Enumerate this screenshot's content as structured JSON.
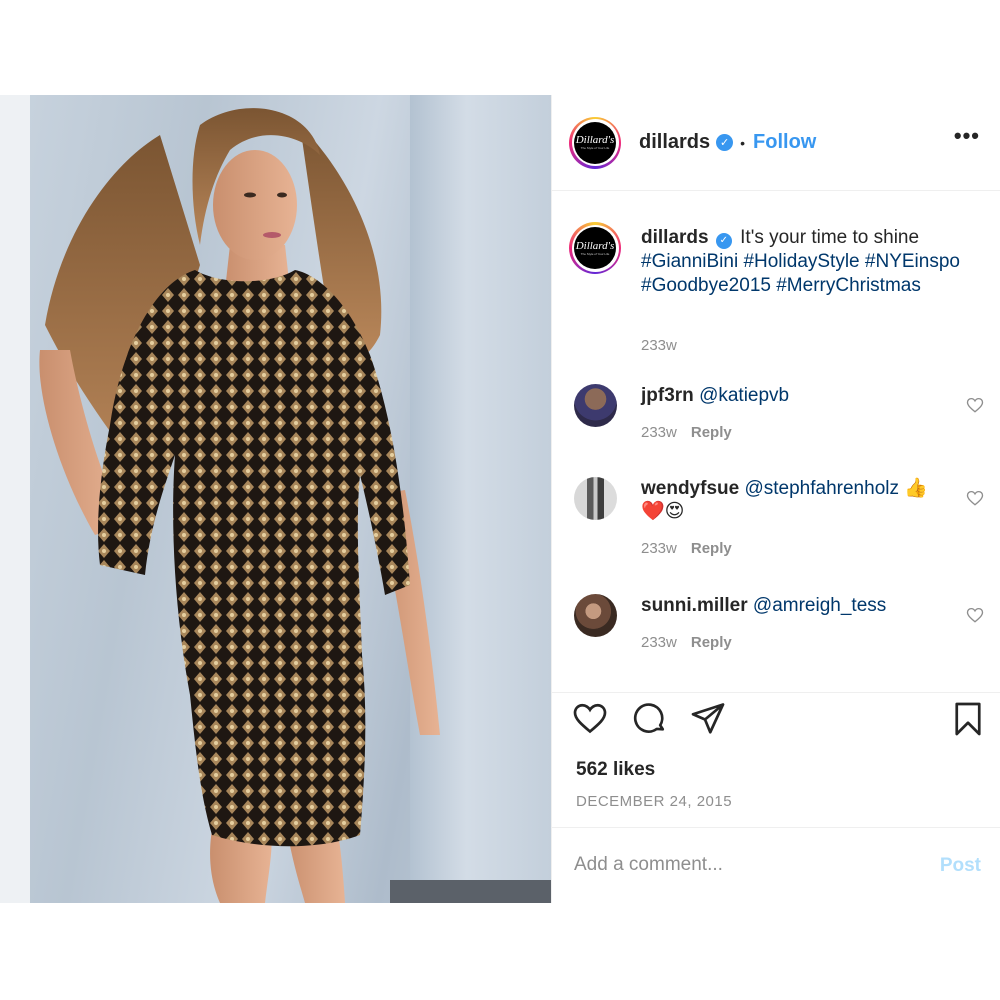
{
  "account": {
    "username": "dillards",
    "follow_label": "Follow",
    "separator": "•",
    "more_label": "•••",
    "verified_mark": "✓",
    "logo_text": "Dillard's",
    "logo_tagline": "The Style of Your Life"
  },
  "caption": {
    "username": "dillards",
    "text": "It's your time to shine",
    "hashtags": [
      "#GianniBini",
      "#HolidayStyle",
      "#NYEinspo",
      "#Goodbye2015",
      "#MerryChristmas"
    ],
    "time": "233w"
  },
  "comments": [
    {
      "username": "jpf3rn",
      "text": "@katiepvb",
      "time": "233w",
      "reply_label": "Reply"
    },
    {
      "username": "wendyfsue",
      "text": "@stephfahrenholz",
      "emoji": "👍❤️😍",
      "time": "233w",
      "reply_label": "Reply"
    },
    {
      "username": "sunni.miller",
      "text": "@amreigh_tess",
      "time": "233w",
      "reply_label": "Reply"
    }
  ],
  "icons": [
    "heart-icon",
    "comment-icon",
    "share-icon",
    "bookmark-icon"
  ],
  "likes": "562 likes",
  "date": "DECEMBER 24, 2015",
  "add_comment": {
    "placeholder": "Add a comment...",
    "post_label": "Post"
  },
  "colors": {
    "link": "#3897f0",
    "hashtag": "#00376b",
    "muted": "#8e8e8e",
    "post_disabled": "#b2dffc"
  }
}
